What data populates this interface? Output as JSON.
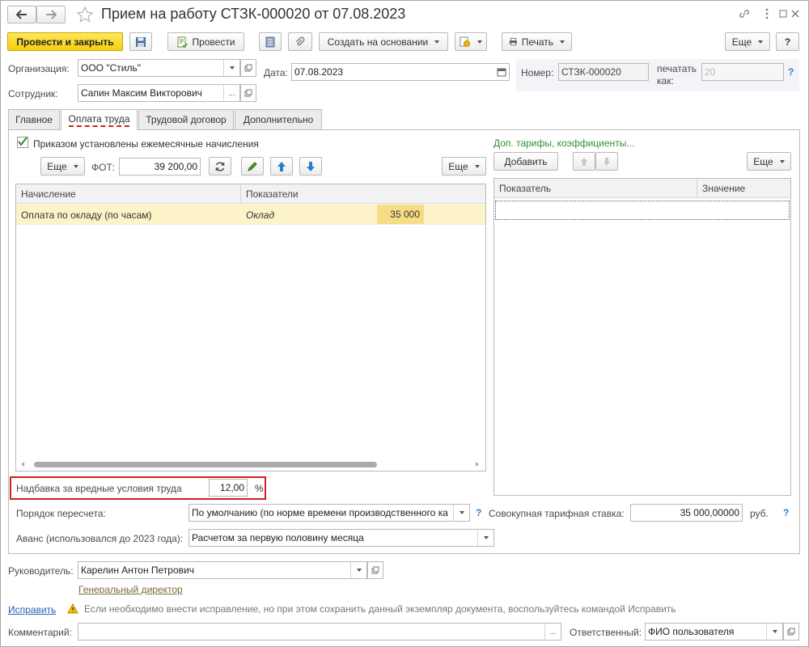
{
  "title": "Прием на работу СТЗК-000020 от 07.08.2023",
  "toolbar": {
    "post_close": "Провести и закрыть",
    "post": "Провести",
    "create_based_on": "Создать на основании",
    "print": "Печать",
    "more": "Еще",
    "help": "?"
  },
  "header": {
    "org_label": "Организация:",
    "org_value": "ООО \"Стиль\"",
    "date_label": "Дата:",
    "date_value": "07.08.2023",
    "number_label": "Номер:",
    "number_value": "СТЗК-000020",
    "print_as_label_1": "печатать",
    "print_as_label_2": "как:",
    "print_as_value": "20",
    "employee_label": "Сотрудник:",
    "employee_value": "Сапин Максим Викторович"
  },
  "tabs": [
    "Главное",
    "Оплата труда",
    "Трудовой договор",
    "Дополнительно"
  ],
  "payroll": {
    "monthly_accruals_checkbox": "Приказом установлены ежемесячные начисления",
    "monthly_accruals_checked": true,
    "more": "Еще",
    "fot_label": "ФОТ:",
    "fot_value": "39 200,00",
    "more_right": "Еще",
    "columns": [
      "Начисление",
      "Показатели"
    ],
    "rows": [
      {
        "accrual": "Оплата по окладу (по часам)",
        "indicator": "Оклад",
        "value": "35 000"
      }
    ],
    "hazard_label": "Надбавка за вредные условия труда",
    "hazard_value": "12,00",
    "hazard_unit": "%",
    "recalc_label": "Порядок пересчета:",
    "recalc_value": "По умолчанию (по норме времени производственного ка",
    "advance_label": "Аванс (использовался до 2023 года):",
    "advance_value": "Расчетом за первую половину месяца",
    "total_rate_label": "Совокупная тарифная ставка:",
    "total_rate_value": "35 000,00000",
    "total_rate_unit": "руб."
  },
  "tariffs": {
    "link": "Доп. тарифы, коэффициенты...",
    "add": "Добавить",
    "more": "Еще",
    "columns": [
      "Показатель",
      "Значение"
    ]
  },
  "footer": {
    "head_label": "Руководитель:",
    "head_value": "Карелин Антон Петрович",
    "head_position": "Генеральный директор",
    "fix_link": "Исправить",
    "fix_note": "Если необходимо внести исправление, но при этом сохранить данный экземпляр документа, воспользуйтесь командой Исправить",
    "comment_label": "Комментарий:",
    "comment_value": "",
    "responsible_label": "Ответственный:",
    "responsible_value": "ФИО пользователя"
  },
  "colors": {
    "accent_yellow": "#f5cf0d",
    "selected_row": "#fcf3c8",
    "highlight_border": "#d2201e",
    "link_green": "#2f8f3a",
    "link_blue": "#2661b8"
  }
}
